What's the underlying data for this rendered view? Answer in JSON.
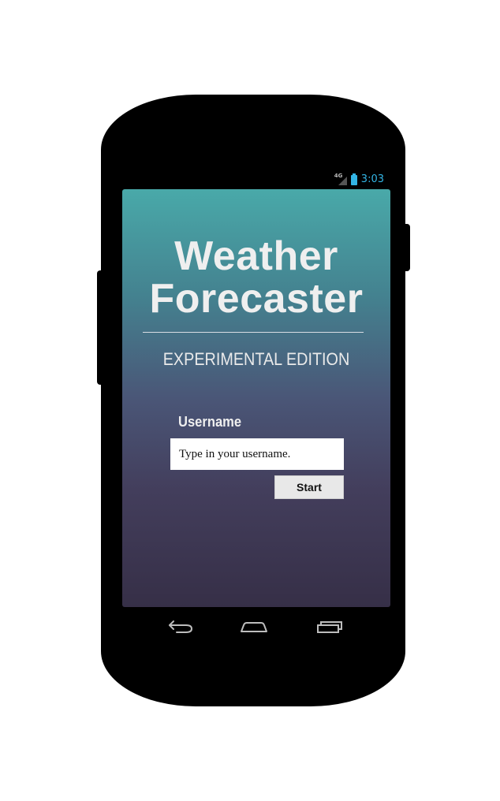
{
  "status_bar": {
    "network_label": "4G",
    "network_icon": "signal-icon",
    "battery_icon": "battery-icon",
    "time": "3:03",
    "accent_color": "#33b5e5"
  },
  "app": {
    "title_line1": "Weather",
    "title_line2": "Forecaster",
    "subtitle": "EXPERIMENTAL EDITION",
    "gradient_colors": [
      "#49a9a9",
      "#44818f",
      "#4a5677",
      "#433e5c",
      "#362f47"
    ],
    "text_color": "#efefef"
  },
  "form": {
    "username_label": "Username",
    "username_placeholder": "Type in your username.",
    "username_value": "",
    "start_label": "Start"
  },
  "nav_bar": {
    "back_icon": "back-icon",
    "home_icon": "home-icon",
    "recents_icon": "recents-icon"
  }
}
